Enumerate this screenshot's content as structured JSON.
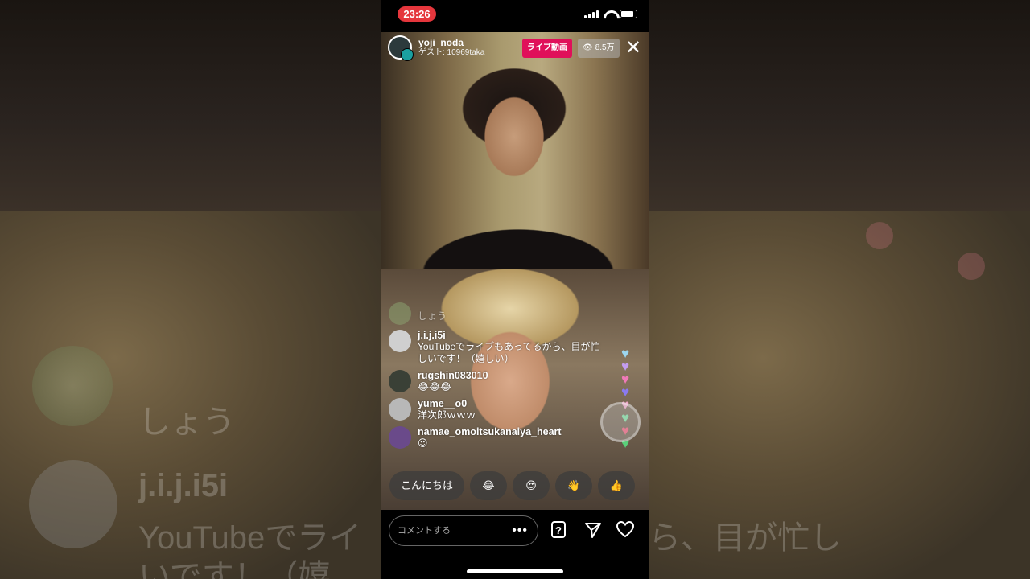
{
  "status_bar": {
    "time": "23:26"
  },
  "host": {
    "username": "yoji_noda",
    "guest_line": "ゲスト: 10969taka",
    "live_label": "ライブ動画",
    "viewers": "8.5万",
    "close_icon": "close-icon"
  },
  "comments": [
    {
      "username": "",
      "text": "しょう",
      "avatar_color": "#8aa070",
      "faded": true
    },
    {
      "username": "j.i.j.i5i",
      "text": "YouTubeでライブもあってるから、目が忙しいです！（嬉しい）",
      "avatar_color": "#cfcfcf"
    },
    {
      "username": "rugshin083010",
      "text": "😂😂😂",
      "avatar_color": "#3a4036"
    },
    {
      "username": "yume__o0",
      "text": "洋次郎ｗｗｗ",
      "avatar_color": "#b8b8b8"
    },
    {
      "username": "namae_omoitsukanaiya_heart",
      "text": "😍",
      "avatar_color": "#6a4a8a"
    }
  ],
  "reactions": [
    "こんにちは",
    "😂",
    "😍",
    "👋",
    "👍"
  ],
  "comment_bar": {
    "placeholder": "コメントする",
    "more": "•••"
  },
  "background": {
    "left_ghost_1": "j.i.j.i5i",
    "left_ghost_2": "YouTubeでライ",
    "left_ghost_3": "いです！（嬉",
    "left_ghost_4": "しょう",
    "right_ghost_1": "ら、目が忙し"
  },
  "colors": {
    "live_badge": "#e0105a",
    "time_pill": "#e5363c"
  }
}
